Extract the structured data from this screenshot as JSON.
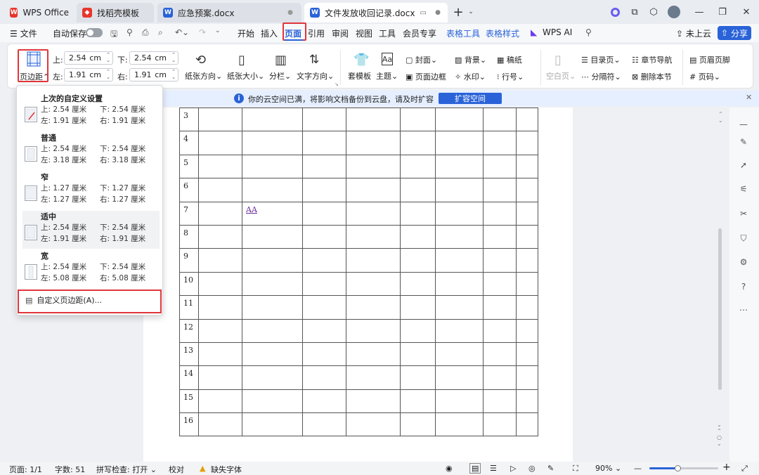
{
  "tabs": [
    {
      "label": "WPS Office"
    },
    {
      "label": "找稻壳模板"
    },
    {
      "label": "应急预案.docx"
    },
    {
      "label": "文件发放收回记录.docx"
    }
  ],
  "menu": {
    "file": "文件",
    "autosave": "自动保存",
    "items": [
      "开始",
      "插入",
      "页面",
      "引用",
      "审阅",
      "视图",
      "工具",
      "会员专享"
    ],
    "table_tools": "表格工具",
    "table_style": "表格样式",
    "wps_ai": "WPS AI",
    "cloud": "未上云",
    "share": "分享"
  },
  "ribbon": {
    "margins": "页边距",
    "top_label": "上:",
    "top_value": "2.54",
    "bottom_label": "下:",
    "bottom_value": "2.54",
    "left_label": "左:",
    "left_value": "1.91",
    "right_label": "右:",
    "right_value": "1.91",
    "unit": "cm",
    "orientation": "纸张方向",
    "size": "纸张大小",
    "columns": "分栏",
    "text_direction": "文字方向",
    "theme_template": "套模板",
    "theme": "主题",
    "cover": "封面",
    "page_border": "页面边框",
    "background": "背景",
    "watermark": "水印",
    "manuscript": "稿纸",
    "line_number": "行号",
    "blank_page": "空白页",
    "toc_page": "目录页",
    "section_break": "分隔符",
    "chapter_nav": "章节导航",
    "delete_section": "删除本节",
    "header_footer": "页眉页脚",
    "page_number": "页码"
  },
  "notice": {
    "text": "你的云空间已满，将影响文档备份到云盘，请及时扩容",
    "button": "扩容空间"
  },
  "dropdown": {
    "presets": [
      {
        "name": "上次的自定义设置",
        "top": "上: 2.54 厘米",
        "bottom": "下: 2.54 厘米",
        "left": "左: 1.91 厘米",
        "right": "右: 1.91 厘米"
      },
      {
        "name": "普通",
        "top": "上: 2.54 厘米",
        "bottom": "下: 2.54 厘米",
        "left": "左: 3.18 厘米",
        "right": "右: 3.18 厘米"
      },
      {
        "name": "窄",
        "top": "上: 1.27 厘米",
        "bottom": "下: 1.27 厘米",
        "left": "左: 1.27 厘米",
        "right": "右: 1.27 厘米"
      },
      {
        "name": "适中",
        "top": "上: 2.54 厘米",
        "bottom": "下: 2.54 厘米",
        "left": "左: 1.91 厘米",
        "right": "右: 1.91 厘米"
      },
      {
        "name": "宽",
        "top": "上: 2.54 厘米",
        "bottom": "下: 2.54 厘米",
        "left": "左: 5.08 厘米",
        "right": "右: 5.08 厘米"
      }
    ],
    "custom": "自定义页边距(A)..."
  },
  "document": {
    "row_numbers": [
      "3",
      "4",
      "5",
      "6",
      "7",
      "8",
      "9",
      "10",
      "11",
      "12",
      "13",
      "14",
      "15",
      "16"
    ],
    "cell_text": "AA"
  },
  "status": {
    "page": "页面: 1/1",
    "words": "字数: 51",
    "spell": "拼写检查: 打开",
    "proof": "校对",
    "missing_font": "缺失字体",
    "zoom": "90%"
  },
  "colors": {
    "accent": "#2a63d8",
    "highlight": "#e0363b",
    "wps_red": "#e8352d"
  }
}
